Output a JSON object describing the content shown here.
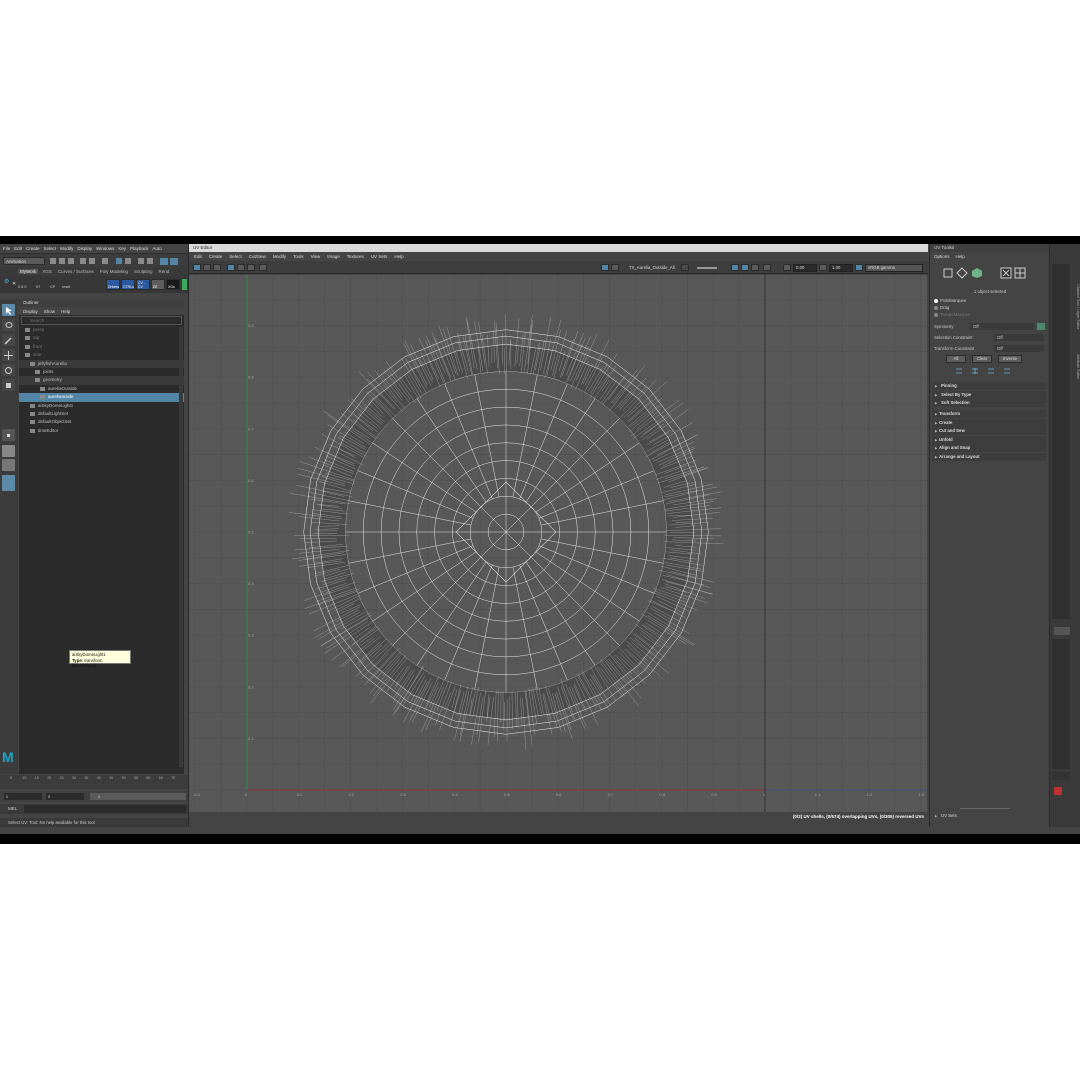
{
  "app": {
    "menubar": [
      "File",
      "Edit",
      "Create",
      "Select",
      "Modify",
      "Display",
      "Windows",
      "Key",
      "Playback",
      "Auto"
    ],
    "mode": "Animation",
    "shelf_tabs": [
      "MyWork",
      "XGS",
      "Curves / Surfaces",
      "Poly Modeling",
      "Sculpting",
      "Rend"
    ],
    "shelf_buttons": [
      "Drivers",
      "CTRLs",
      "CV - CV",
      "ZE",
      "XGs"
    ],
    "statusline_labels": [
      "0.5.0",
      "97",
      "CP",
      "reset"
    ],
    "help_line": "Select UV: Tool: No help available for this tool"
  },
  "outliner": {
    "title": "Outliner",
    "menu": [
      "Display",
      "Show",
      "Help"
    ],
    "search_placeholder": "Search...",
    "rows": [
      {
        "label": "persp",
        "indent": 0,
        "dim": true
      },
      {
        "label": "top",
        "indent": 0,
        "dim": true
      },
      {
        "label": "front",
        "indent": 0,
        "dim": true
      },
      {
        "label": "side",
        "indent": 0,
        "dim": true
      },
      {
        "label": "jellyfishAurelia",
        "indent": 1,
        "dim": false,
        "hl": true
      },
      {
        "label": "joints",
        "indent": 2,
        "dim": false
      },
      {
        "label": "geometry",
        "indent": 2,
        "dim": false,
        "hl": true
      },
      {
        "label": "aureliaOutside",
        "indent": 3,
        "dim": false
      },
      {
        "label": "aureliaInside",
        "indent": 3,
        "dim": false,
        "sel": true
      },
      {
        "label": "aiSkyDomeLight1",
        "indent": 1,
        "dim": false
      },
      {
        "label": "defaultLightSet",
        "indent": 1,
        "dim": false
      },
      {
        "label": "defaultObjectSet",
        "indent": 1,
        "dim": false
      },
      {
        "label": "timeEditor",
        "indent": 1,
        "dim": false
      }
    ],
    "tooltip": {
      "name": "aiSkyDomeLight1",
      "type_label": "Type:",
      "type_value": "transform (kTransform)"
    }
  },
  "timeline": {
    "ticks": [
      "5",
      "10",
      "15",
      "20",
      "25",
      "30",
      "35",
      "40",
      "45",
      "50",
      "55",
      "60",
      "65",
      "70"
    ],
    "start": "0",
    "end": "0",
    "current": "0",
    "mel_label": "MEL"
  },
  "uv_editor": {
    "title": "UV Editor",
    "menu": [
      "Edit",
      "Create",
      "Select",
      "Cut/Sew",
      "Modify",
      "Tools",
      "View",
      "Image",
      "Textures",
      "UV Sets",
      "Help"
    ],
    "texture_name": "TX_Aurelia_Outside_All",
    "exposure": "0.00",
    "gamma": "1.00",
    "color_space": "sRGB gamma",
    "v_axis_labels": [
      "0.9",
      "0.8",
      "0.7",
      "0.6",
      "0.5",
      "0.4",
      "0.3",
      "0.2",
      "0.1"
    ],
    "u_axis_labels": [
      "-0.1",
      "0",
      "0.1",
      "0.2",
      "0.3",
      "0.4",
      "0.5",
      "0.6",
      "0.7",
      "0.8",
      "0.9",
      "1",
      "1.1",
      "1.2",
      "1.3"
    ],
    "status": "(0/2) UV shells, (0/574) overlapping UVs, (0/305) reversed UVs"
  },
  "uv_toolkit": {
    "title": "UV Toolkit",
    "menu": [
      "Options",
      "Help"
    ],
    "selection_info": "1 object selected",
    "pick_modes": [
      {
        "label": "Pick/Marquee",
        "on": true,
        "dim": false
      },
      {
        "label": "Drag",
        "on": false,
        "dim": false
      },
      {
        "label": "Tweak/Marquee",
        "on": false,
        "dim": true
      }
    ],
    "symmetry_label": "Symmetry",
    "symmetry_value": "Off",
    "selection_constraint_label": "Selection Constraint",
    "selection_constraint_value": "Off",
    "transform_constraint_label": "Transform Constraint",
    "transform_constraint_value": "Off",
    "buttons": [
      "All",
      "Clear",
      "Inverse"
    ],
    "sections_a": [
      "Pinning",
      "Select By Type",
      "Soft Selection"
    ],
    "sections_b": [
      "Transform",
      "Create",
      "Cut and Sew",
      "Unfold",
      "Align and Snap",
      "Arrange and Layout"
    ],
    "uv_sets": "UV Sets"
  },
  "right_dock": {
    "tabs": [
      "Channel Box / Layer Editor",
      "Attribute Editor"
    ]
  }
}
